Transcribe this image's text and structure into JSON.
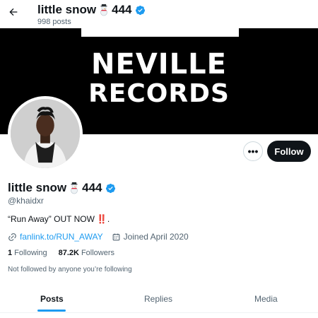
{
  "header": {
    "name": "little snow",
    "name_suffix": "444",
    "posts": "998 posts",
    "back_icon": "arrow-left-icon"
  },
  "banner": {
    "line1": "NEVILLE",
    "line2": "RECORDS"
  },
  "actions": {
    "more": "•••",
    "follow": "Follow"
  },
  "profile": {
    "name": "little snow",
    "name_suffix": "444",
    "handle": "@khaidxr",
    "bio": "“Run Away” OUT NOW",
    "bio_emoji": "‼️",
    "bio_end": ".",
    "link": "fanlink.to/RUN_AWAY",
    "joined": "Joined April 2020",
    "following_count": "1",
    "following_label": "Following",
    "followers_count": "87.2K",
    "followers_label": "Followers",
    "notice": "Not followed by anyone you’re following"
  },
  "tabs": [
    {
      "label": "Posts",
      "active": true
    },
    {
      "label": "Replies",
      "active": false
    },
    {
      "label": "Media",
      "active": false
    }
  ],
  "colors": {
    "accent": "#1d9bf0",
    "text": "#0f1419",
    "muted": "#536471"
  }
}
